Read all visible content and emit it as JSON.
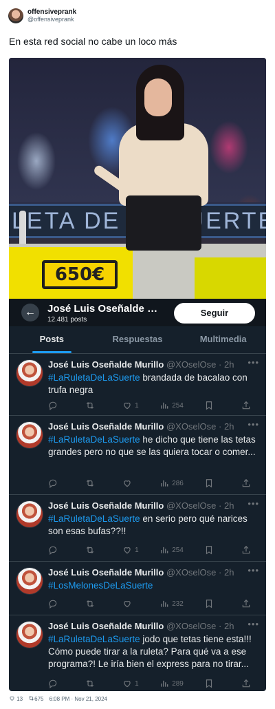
{
  "post": {
    "username": "offensiveprank",
    "handle": "@offensiveprank",
    "text": "En esta red social no cabe un loco más",
    "footer": {
      "likes": "13",
      "retweets": "675",
      "timestamp": "6:08 PM · Nov 21, 2024"
    }
  },
  "banner": {
    "sign_text": "LETA DE LA SUERTE",
    "score": "650€"
  },
  "profile": {
    "back_icon": "←",
    "name": "José Luis Oseñalde M...",
    "posts_count": "12.481 posts",
    "follow_label": "Seguir"
  },
  "tabs": [
    "Posts",
    "Respuestas",
    "Multimedia"
  ],
  "tweets": [
    {
      "name": "José Luis Oseñalde Murillo",
      "handle": "@XOselOse",
      "time": "· 2h",
      "hashtag": "#LaRuletaDeLaSuerte",
      "text": " brandada de bacalao con trufa negra",
      "likes": "1",
      "views": "254"
    },
    {
      "name": "José Luis Oseñalde Murillo",
      "handle": "@XOselOse",
      "time": "· 2h",
      "hashtag": "#LaRuletaDeLaSuerte",
      "text": " he dicho que tiene las tetas grandes pero no que se las quiera tocar o comer...",
      "likes": "",
      "views": "286"
    },
    {
      "name": "José Luis Oseñalde Murillo",
      "handle": "@XOselOse",
      "time": "· 2h",
      "hashtag": "#LaRuletaDeLaSuerte",
      "text": " en serio pero qué narices son esas bufas??!!",
      "likes": "1",
      "views": "254"
    },
    {
      "name": "José Luis Oseñalde Murillo",
      "handle": "@XOselOse",
      "time": "· 2h",
      "hashtag": "#LosMelonesDeLaSuerte",
      "text": "",
      "likes": "",
      "views": "232"
    },
    {
      "name": "José Luis Oseñalde Murillo",
      "handle": "@XOselOse",
      "time": "· 2h",
      "hashtag": "#LaRuletaDeLaSuerte",
      "text": " jodo que tetas tiene esta!!! Cómo puede tirar a la ruleta? Para qué va a ese programa?! Le iría bien el express para no tirar...",
      "likes": "1",
      "views": "289"
    }
  ],
  "colors": {
    "accent": "#1d9bf0",
    "background": "#15202b",
    "muted": "#71767b"
  },
  "icons": [
    "reply-icon",
    "retweet-icon",
    "like-icon",
    "views-icon",
    "bookmark-icon",
    "share-icon",
    "more-icon",
    "back-arrow-icon"
  ]
}
